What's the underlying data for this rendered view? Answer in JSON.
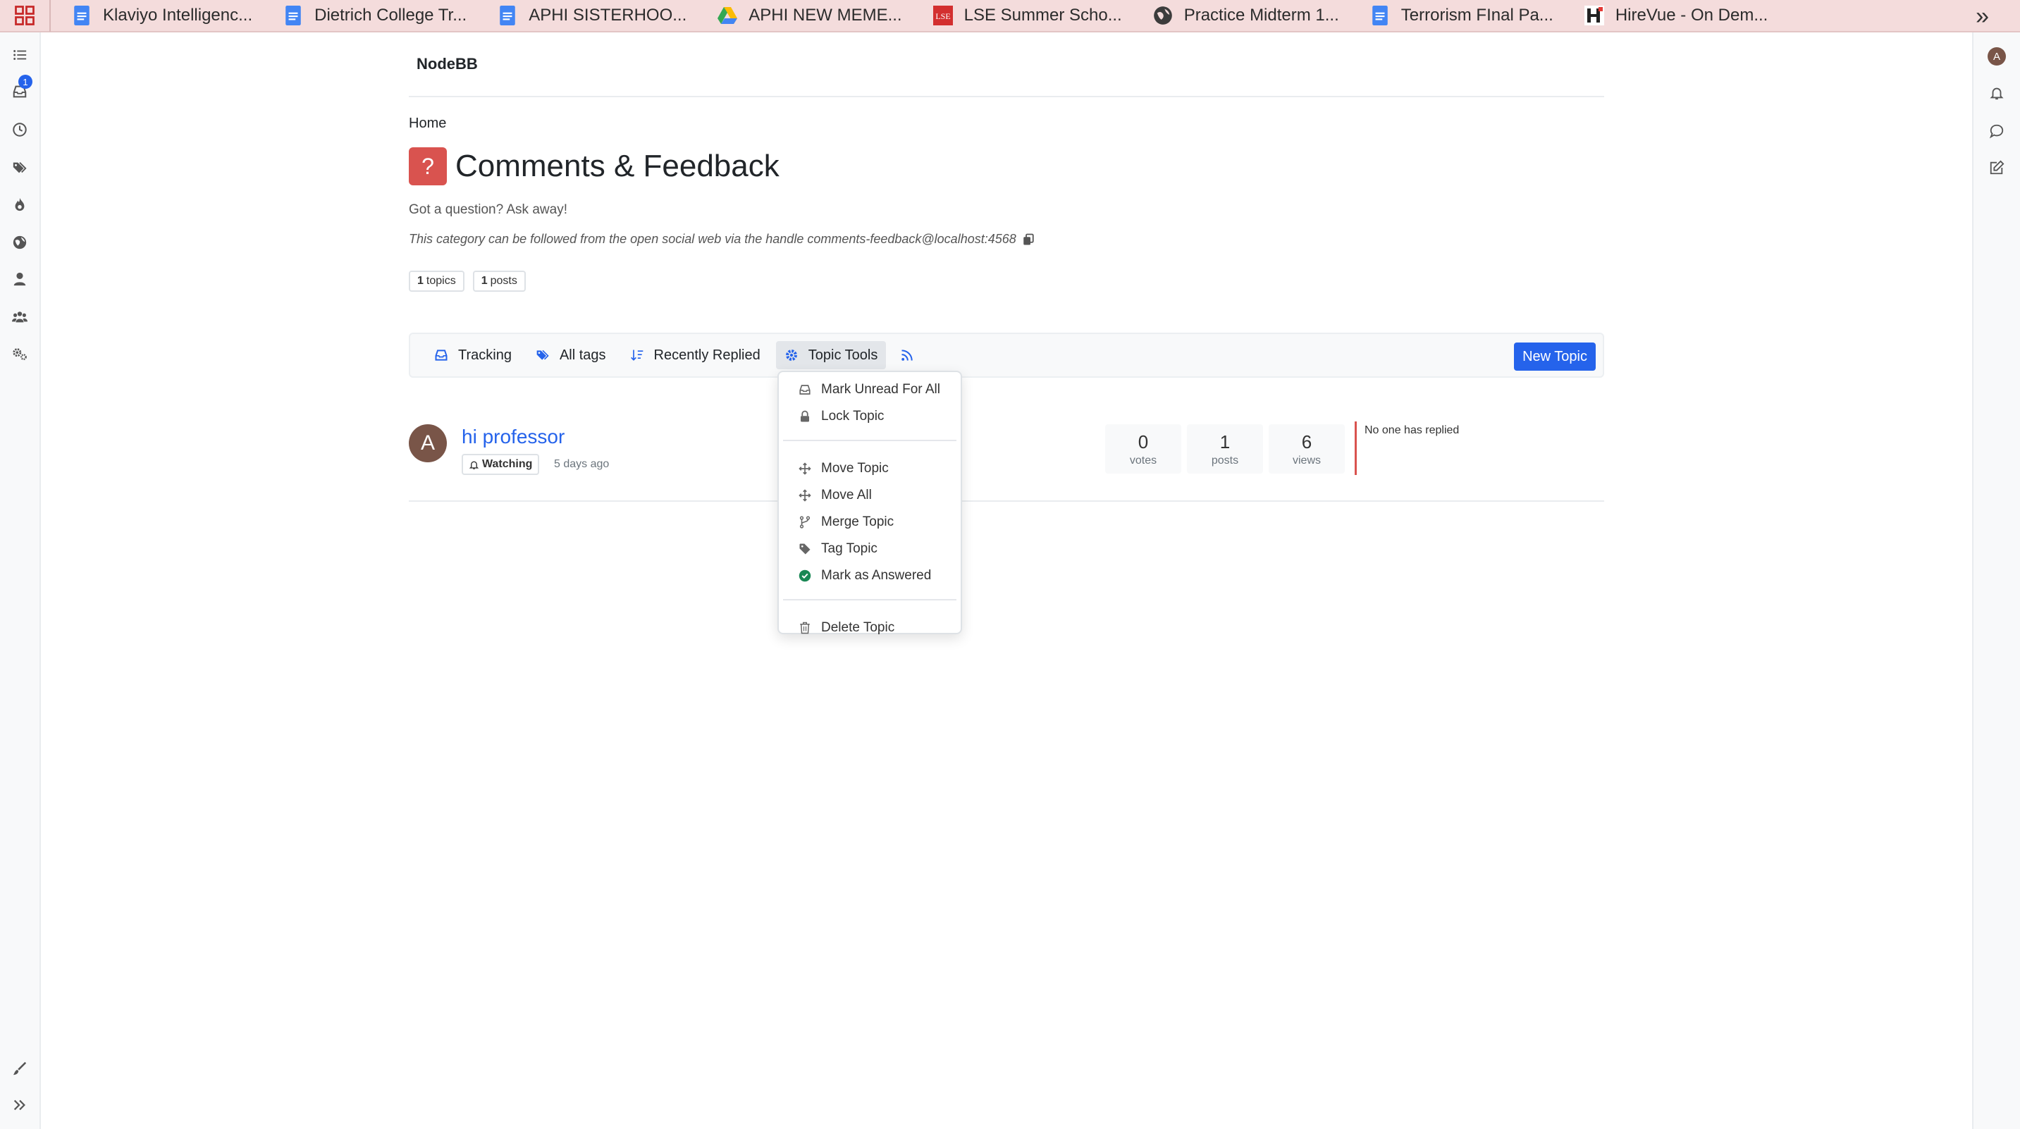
{
  "bookmarks": [
    {
      "label": "Klaviyo Intelligenc...",
      "icon": "google-docs-icon"
    },
    {
      "label": "Dietrich College Tr...",
      "icon": "google-docs-icon"
    },
    {
      "label": "APHI SISTERHOO...",
      "icon": "google-docs-icon"
    },
    {
      "label": "APHI NEW MEME...",
      "icon": "google-drive-icon"
    },
    {
      "label": "LSE Summer Scho...",
      "icon": "lse-logo-icon"
    },
    {
      "label": "Practice Midterm 1...",
      "icon": "globe-icon"
    },
    {
      "label": "Terrorism FInal Pa...",
      "icon": "google-docs-icon"
    },
    {
      "label": "HireVue - On Dem...",
      "icon": "hirevue-icon"
    }
  ],
  "sidebar": {
    "unread_badge": "1"
  },
  "right_sidebar": {
    "avatar_letter": "A"
  },
  "header": {
    "brand": "NodeBB"
  },
  "breadcrumb": "Home",
  "category": {
    "icon_glyph": "?",
    "icon_color": "#d9534f",
    "title": "Comments & Feedback",
    "description": "Got a question? Ask away!",
    "follow_text": "This category can be followed from the open social web via the handle comments-feedback@localhost:4568",
    "topics_count": "1",
    "topics_label": "topics",
    "posts_count": "1",
    "posts_label": "posts"
  },
  "toolbar": {
    "tracking": "Tracking",
    "all_tags": "All tags",
    "sort": "Recently Replied",
    "topic_tools": "Topic Tools",
    "new_topic": "New Topic"
  },
  "topic": {
    "avatar_letter": "A",
    "title": "hi professor",
    "watching": "Watching",
    "time": "5 days ago",
    "votes": "0",
    "votes_label": "votes",
    "posts": "1",
    "posts_label": "posts",
    "views": "6",
    "views_label": "views",
    "last_reply": "No one has replied"
  },
  "topic_tools_menu": {
    "mark_unread_all": "Mark Unread For All",
    "lock": "Lock Topic",
    "move": "Move Topic",
    "move_all": "Move All",
    "merge": "Merge Topic",
    "tag": "Tag Topic",
    "mark_answered": "Mark as Answered",
    "delete": "Delete Topic"
  },
  "colors": {
    "accent": "#2563eb",
    "category": "#d9534f",
    "answered": "#198754"
  }
}
